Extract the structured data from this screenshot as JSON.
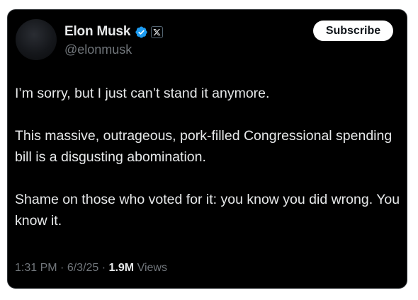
{
  "author": {
    "display_name": "Elon Musk",
    "handle": "@elonmusk",
    "verified_icon": "verified-badge-icon",
    "affiliation_icon": "x-logo-icon"
  },
  "actions": {
    "subscribe_label": "Subscribe"
  },
  "tweet": {
    "paragraphs": [
      "I’m sorry, but I just can’t stand it anymore.",
      "This massive, outrageous, pork-filled Congressional spending bill is a disgusting abomination.",
      "Shame on those who voted for it: you know you did wrong. You know it."
    ]
  },
  "meta": {
    "time": "1:31 PM",
    "separator": "·",
    "date": "6/3/25",
    "views_count": "1.9M",
    "views_label": "Views"
  },
  "colors": {
    "card_background": "#000000",
    "primary_text": "#e7e9ea",
    "secondary_text": "#71767b",
    "verified_blue": "#1d9bf0"
  }
}
